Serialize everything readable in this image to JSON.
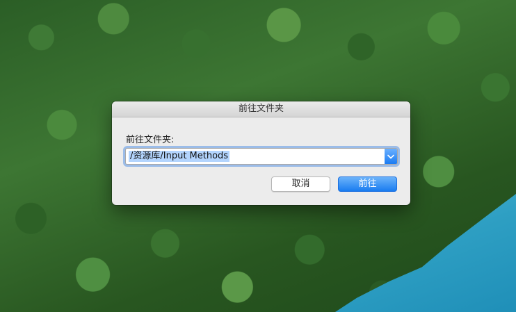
{
  "dialog": {
    "title": "前往文件夹",
    "label": "前往文件夹:",
    "path_value": "/资源库/Input Methods",
    "cancel_label": "取消",
    "go_label": "前往"
  },
  "icons": {
    "combo_arrow": "chevron-down-icon"
  },
  "colors": {
    "accent": "#1a7bf2",
    "selection": "#b3d4fd"
  }
}
